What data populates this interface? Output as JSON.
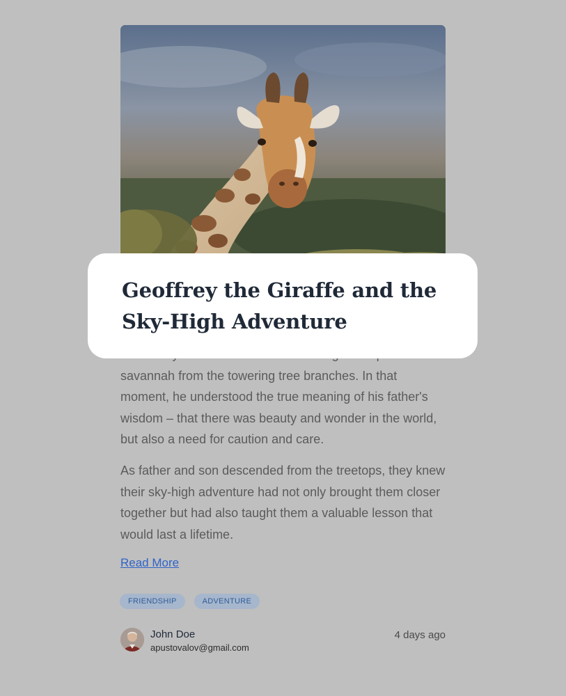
{
  "article": {
    "title": "Geoffrey the Giraffe and the Sky-High Adventure",
    "paragraphs": [
      "Gavin's eyes widened with awe as he gazed upon the vast savannah from the towering tree branches. In that moment, he understood the true meaning of his father's wisdom – that there was beauty and wonder in the world, but also a need for caution and care.",
      "As father and son descended from the treetops, they knew their sky-high adventure had not only brought them closer together but had also taught them a valuable lesson that would last a lifetime."
    ],
    "read_more_label": "Read More",
    "tags": [
      "FRIENDSHIP",
      "ADVENTURE"
    ]
  },
  "author": {
    "name": "John Doe",
    "email": "apustovalov@gmail.com",
    "posted": "4 days ago"
  },
  "colors": {
    "page_background": "#bfbfbf",
    "highlight": "#ffffff",
    "link": "#2f64c9",
    "tag_background": "#a6b6cc",
    "tag_text": "#2f5c98"
  }
}
